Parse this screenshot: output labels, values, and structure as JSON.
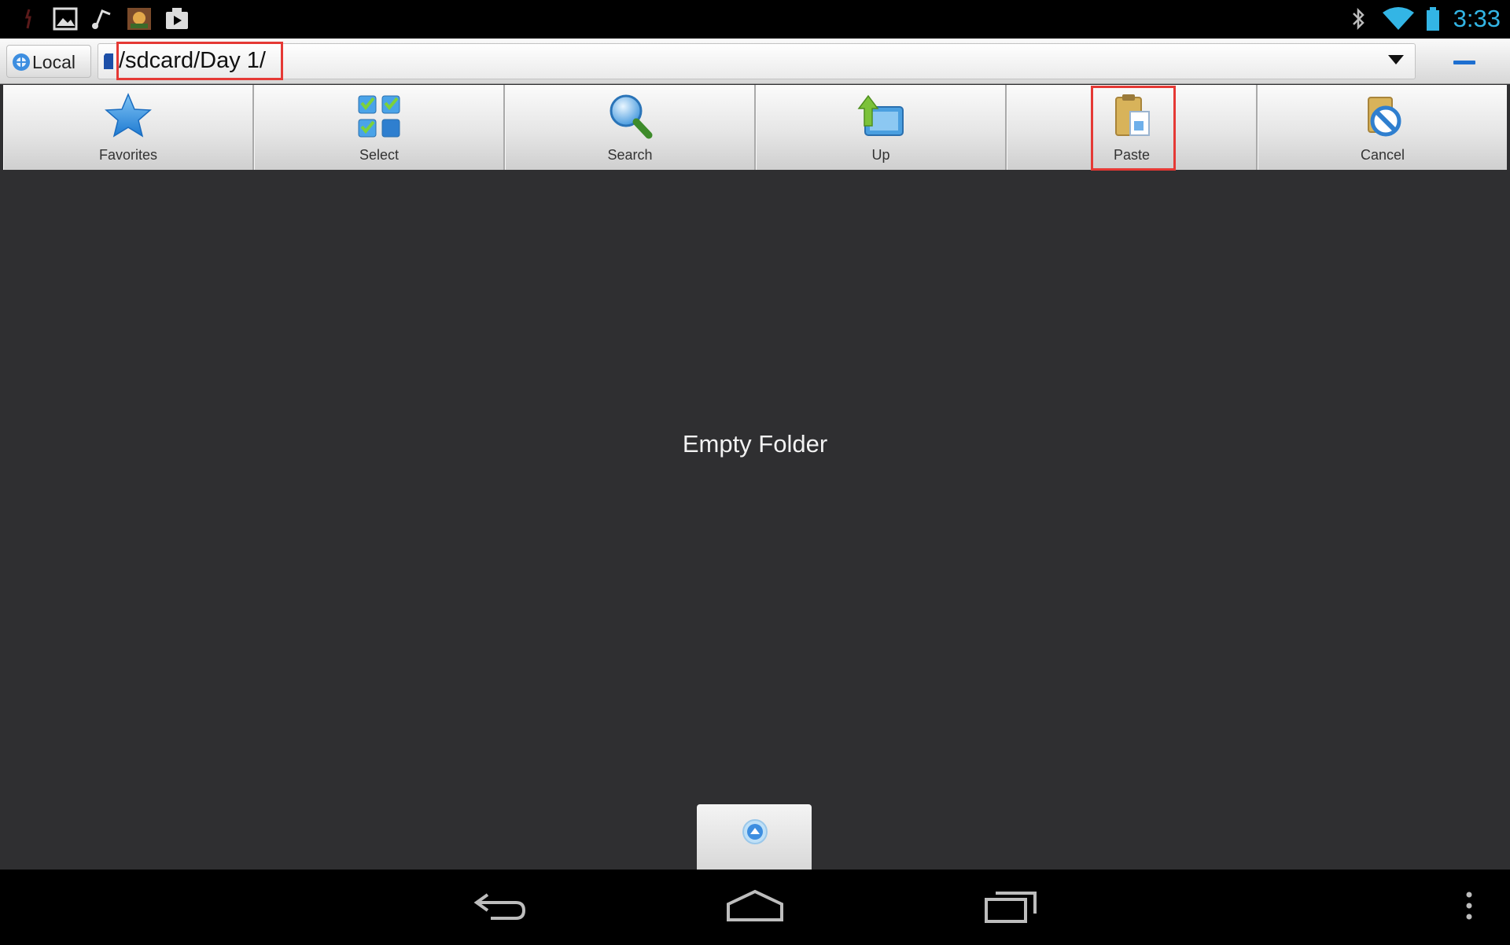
{
  "status_bar": {
    "time": "3:33",
    "notification_icons": [
      "usb-debug-icon",
      "image-icon",
      "music-icon",
      "app-icon",
      "download-icon"
    ],
    "system_icons": [
      "bluetooth-icon",
      "wifi-icon",
      "battery-icon"
    ],
    "accent_color": "#33b5e5"
  },
  "address_bar": {
    "location_button": "Local",
    "path": "/sdcard/Day 1/"
  },
  "toolbar": {
    "buttons": [
      {
        "label": "Favorites",
        "icon": "star-icon"
      },
      {
        "label": "Select",
        "icon": "select-grid-icon"
      },
      {
        "label": "Search",
        "icon": "magnifier-icon"
      },
      {
        "label": "Up",
        "icon": "folder-up-icon"
      },
      {
        "label": "Paste",
        "icon": "clipboard-icon"
      },
      {
        "label": "Cancel",
        "icon": "cancel-icon"
      }
    ],
    "highlighted": "Paste",
    "highlight_color": "#e53935"
  },
  "content": {
    "empty_message": "Empty Folder"
  },
  "navigation": {
    "buttons": [
      "back-icon",
      "home-icon",
      "recent-apps-icon",
      "overflow-menu-icon"
    ]
  }
}
